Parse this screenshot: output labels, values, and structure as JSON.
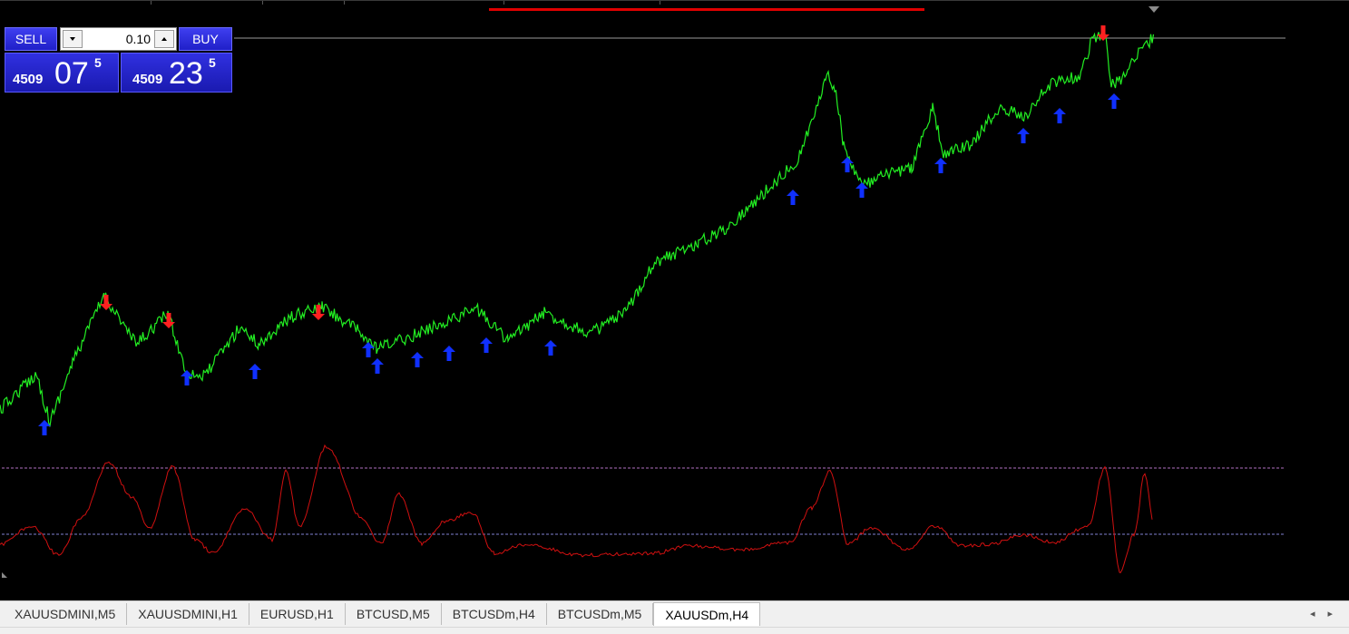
{
  "colors": {
    "background": "#000000",
    "price_line": "#22ee22",
    "buy_arrow": "#1030ff",
    "sell_arrow": "#ff2020",
    "oscillator": "#d01010",
    "level_lines": "#b070c0",
    "bid_line": "#9a9a9a",
    "trade_button": "#2828d8"
  },
  "trade_panel": {
    "sell_label": "SELL",
    "buy_label": "BUY",
    "lot_size": "0.10",
    "bid": {
      "big_figure": "4509",
      "pips": "07",
      "fraction": "5"
    },
    "ask": {
      "big_figure": "4509",
      "pips": "23",
      "fraction": "5"
    }
  },
  "tabs": [
    {
      "label": "XAUUSDMINI,M5",
      "active": false
    },
    {
      "label": "XAUUSDMINI,H1",
      "active": false
    },
    {
      "label": "EURUSD,H1",
      "active": false
    },
    {
      "label": "BTCUSD,M5",
      "active": false
    },
    {
      "label": "BTCUSDm,H4",
      "active": false
    },
    {
      "label": "BTCUSDm,M5",
      "active": false
    },
    {
      "label": "XAUUSDm,H4",
      "active": true
    }
  ],
  "icons": {
    "lot_down": "spinner-down-icon",
    "lot_up": "spinner-up-icon",
    "tabs_left": "scroll-left-icon",
    "tabs_right": "scroll-right-icon"
  },
  "tab_arrows": {
    "left": "◂",
    "right": "▸"
  },
  "oscillator_levels": {
    "upper": 70,
    "lower": 30
  }
}
